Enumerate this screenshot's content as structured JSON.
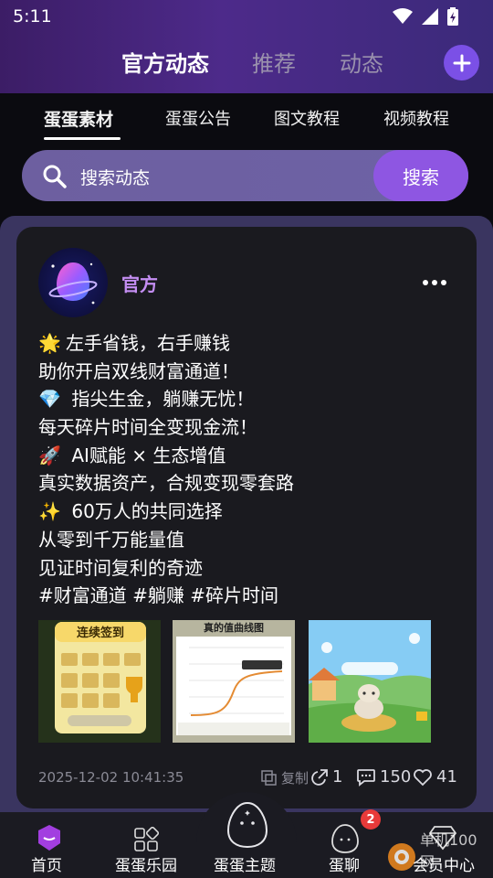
{
  "status": {
    "time": "5:11"
  },
  "main_tabs": [
    {
      "label": "官方动态",
      "active": true
    },
    {
      "label": "推荐",
      "active": false
    },
    {
      "label": "动态",
      "active": false
    }
  ],
  "sub_tabs": [
    {
      "label": "蛋蛋素材",
      "active": true
    },
    {
      "label": "蛋蛋公告",
      "active": false
    },
    {
      "label": "图文教程",
      "active": false
    },
    {
      "label": "视频教程",
      "active": false
    }
  ],
  "search": {
    "placeholder": "搜索动态",
    "button": "搜索"
  },
  "post": {
    "author": "官方",
    "lines": [
      {
        "emoji": "🌟",
        "text": "左手省钱，右手赚钱"
      },
      {
        "emoji": "",
        "text": "助你开启双线财富通道！"
      },
      {
        "emoji": "💎",
        "text": " 指尖生金，躺赚无忧！"
      },
      {
        "emoji": "",
        "text": "每天碎片时间全变现金流！"
      },
      {
        "emoji": "🚀",
        "text": " AI赋能 × 生态增值"
      },
      {
        "emoji": "",
        "text": "真实数据资产，合规变现零套路"
      },
      {
        "emoji": "✨",
        "text": " 60万人的共同选择"
      },
      {
        "emoji": "",
        "text": "从零到千万能量值"
      },
      {
        "emoji": "",
        "text": "见证时间复利的奇迹"
      },
      {
        "emoji": "",
        "text": "#财富通道 #躺赚 #碎片时间"
      }
    ],
    "thumb1_label": "连续签到",
    "thumb2_label": "真的值曲线图",
    "date": "2025-12-02 10:41:35",
    "copy_label": "复制",
    "shares": "1",
    "comments": "150",
    "likes": "41"
  },
  "bottom_nav": [
    {
      "label": "首页",
      "active": true
    },
    {
      "label": "蛋蛋乐园",
      "active": false
    },
    {
      "label": "蛋蛋主题",
      "active": false
    },
    {
      "label": "蛋聊",
      "active": false,
      "badge": "2"
    },
    {
      "label": "会员中心",
      "active": false
    }
  ],
  "watermark": "单机100网",
  "colors": {
    "accent": "#8e56e2",
    "author": "#c48ef2",
    "badge": "#e83a3a"
  }
}
